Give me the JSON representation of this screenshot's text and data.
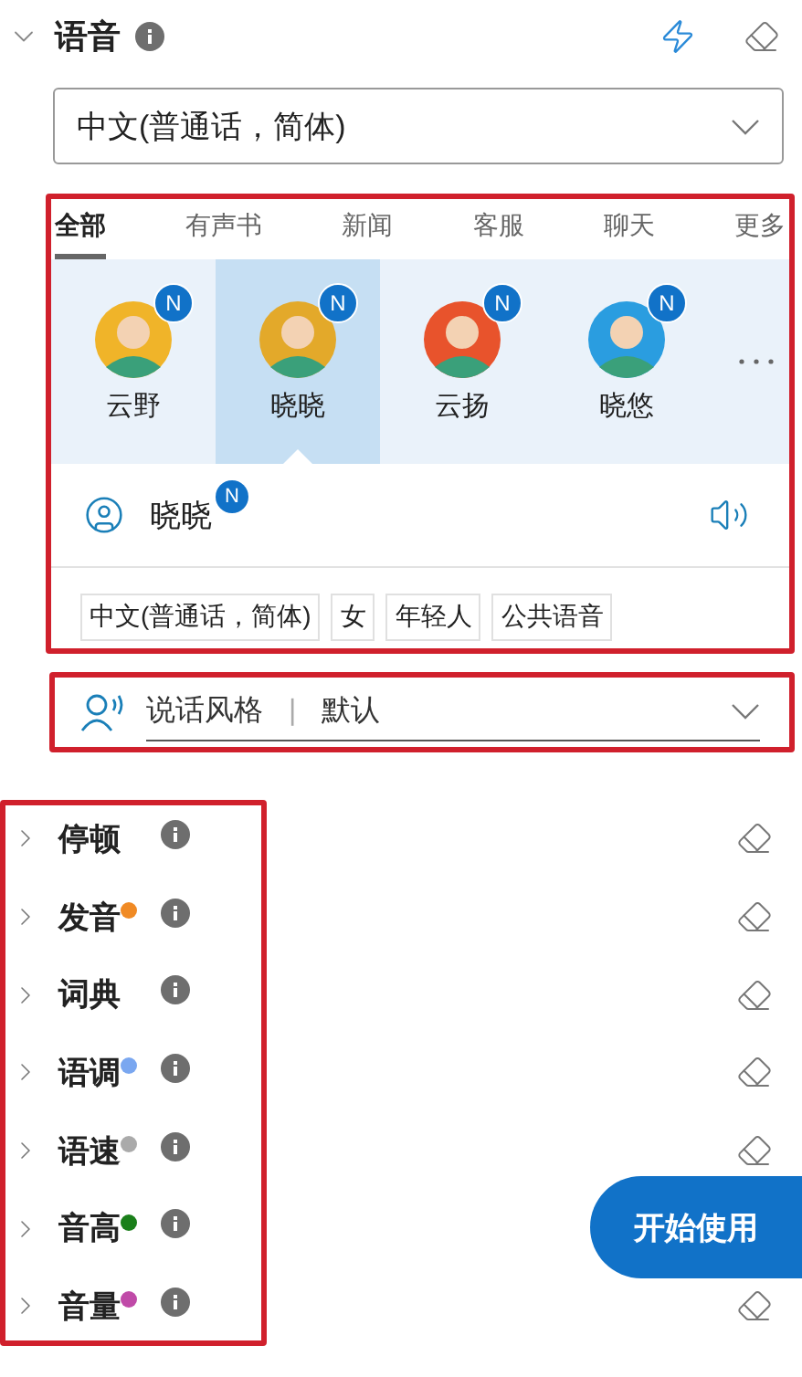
{
  "voice": {
    "title": "语音",
    "language": "中文(普通话，简体)",
    "tabs": [
      {
        "label": "全部",
        "selected": true
      },
      {
        "label": "有声书",
        "selected": false
      },
      {
        "label": "新闻",
        "selected": false
      },
      {
        "label": "客服",
        "selected": false
      },
      {
        "label": "聊天",
        "selected": false
      },
      {
        "label": "更多",
        "selected": false
      }
    ],
    "voices": [
      {
        "name": "云野",
        "badge": "N",
        "selected": false,
        "color": "#f0b429"
      },
      {
        "name": "晓晓",
        "badge": "N",
        "selected": true,
        "color": "#e3a92a"
      },
      {
        "name": "云扬",
        "badge": "N",
        "selected": false,
        "color": "#e8532c"
      },
      {
        "name": "晓悠",
        "badge": "N",
        "selected": false,
        "color": "#2a9de0"
      }
    ],
    "detail": {
      "name": "晓晓",
      "badge": "N"
    },
    "tags": [
      "中文(普通话，简体)",
      "女",
      "年轻人",
      "公共语音"
    ],
    "style": {
      "label": "说话风格",
      "separator": "|",
      "value": "默认"
    }
  },
  "sections": [
    {
      "label": "停顿",
      "eraser": true
    },
    {
      "label": "发音",
      "color": "#f08a24",
      "eraser": true
    },
    {
      "label": "词典",
      "eraser": true
    },
    {
      "label": "语调",
      "color": "#7aa7f0",
      "eraser": true
    },
    {
      "label": "语速",
      "color": "#aaaaaa",
      "eraser": true
    },
    {
      "label": "音高",
      "color": "#1a7f1a",
      "eraser": false
    },
    {
      "label": "音量",
      "color": "#c04aa8",
      "eraser": true
    }
  ],
  "button": "开始使用"
}
